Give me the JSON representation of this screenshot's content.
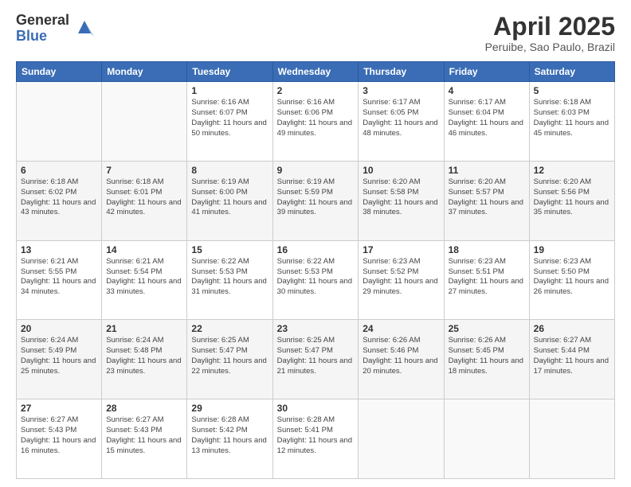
{
  "logo": {
    "general": "General",
    "blue": "Blue"
  },
  "title": {
    "month_year": "April 2025",
    "location": "Peruibe, Sao Paulo, Brazil"
  },
  "weekdays": [
    "Sunday",
    "Monday",
    "Tuesday",
    "Wednesday",
    "Thursday",
    "Friday",
    "Saturday"
  ],
  "weeks": [
    [
      {
        "day": "",
        "sunrise": "",
        "sunset": "",
        "daylight": ""
      },
      {
        "day": "",
        "sunrise": "",
        "sunset": "",
        "daylight": ""
      },
      {
        "day": "1",
        "sunrise": "Sunrise: 6:16 AM",
        "sunset": "Sunset: 6:07 PM",
        "daylight": "Daylight: 11 hours and 50 minutes."
      },
      {
        "day": "2",
        "sunrise": "Sunrise: 6:16 AM",
        "sunset": "Sunset: 6:06 PM",
        "daylight": "Daylight: 11 hours and 49 minutes."
      },
      {
        "day": "3",
        "sunrise": "Sunrise: 6:17 AM",
        "sunset": "Sunset: 6:05 PM",
        "daylight": "Daylight: 11 hours and 48 minutes."
      },
      {
        "day": "4",
        "sunrise": "Sunrise: 6:17 AM",
        "sunset": "Sunset: 6:04 PM",
        "daylight": "Daylight: 11 hours and 46 minutes."
      },
      {
        "day": "5",
        "sunrise": "Sunrise: 6:18 AM",
        "sunset": "Sunset: 6:03 PM",
        "daylight": "Daylight: 11 hours and 45 minutes."
      }
    ],
    [
      {
        "day": "6",
        "sunrise": "Sunrise: 6:18 AM",
        "sunset": "Sunset: 6:02 PM",
        "daylight": "Daylight: 11 hours and 43 minutes."
      },
      {
        "day": "7",
        "sunrise": "Sunrise: 6:18 AM",
        "sunset": "Sunset: 6:01 PM",
        "daylight": "Daylight: 11 hours and 42 minutes."
      },
      {
        "day": "8",
        "sunrise": "Sunrise: 6:19 AM",
        "sunset": "Sunset: 6:00 PM",
        "daylight": "Daylight: 11 hours and 41 minutes."
      },
      {
        "day": "9",
        "sunrise": "Sunrise: 6:19 AM",
        "sunset": "Sunset: 5:59 PM",
        "daylight": "Daylight: 11 hours and 39 minutes."
      },
      {
        "day": "10",
        "sunrise": "Sunrise: 6:20 AM",
        "sunset": "Sunset: 5:58 PM",
        "daylight": "Daylight: 11 hours and 38 minutes."
      },
      {
        "day": "11",
        "sunrise": "Sunrise: 6:20 AM",
        "sunset": "Sunset: 5:57 PM",
        "daylight": "Daylight: 11 hours and 37 minutes."
      },
      {
        "day": "12",
        "sunrise": "Sunrise: 6:20 AM",
        "sunset": "Sunset: 5:56 PM",
        "daylight": "Daylight: 11 hours and 35 minutes."
      }
    ],
    [
      {
        "day": "13",
        "sunrise": "Sunrise: 6:21 AM",
        "sunset": "Sunset: 5:55 PM",
        "daylight": "Daylight: 11 hours and 34 minutes."
      },
      {
        "day": "14",
        "sunrise": "Sunrise: 6:21 AM",
        "sunset": "Sunset: 5:54 PM",
        "daylight": "Daylight: 11 hours and 33 minutes."
      },
      {
        "day": "15",
        "sunrise": "Sunrise: 6:22 AM",
        "sunset": "Sunset: 5:53 PM",
        "daylight": "Daylight: 11 hours and 31 minutes."
      },
      {
        "day": "16",
        "sunrise": "Sunrise: 6:22 AM",
        "sunset": "Sunset: 5:53 PM",
        "daylight": "Daylight: 11 hours and 30 minutes."
      },
      {
        "day": "17",
        "sunrise": "Sunrise: 6:23 AM",
        "sunset": "Sunset: 5:52 PM",
        "daylight": "Daylight: 11 hours and 29 minutes."
      },
      {
        "day": "18",
        "sunrise": "Sunrise: 6:23 AM",
        "sunset": "Sunset: 5:51 PM",
        "daylight": "Daylight: 11 hours and 27 minutes."
      },
      {
        "day": "19",
        "sunrise": "Sunrise: 6:23 AM",
        "sunset": "Sunset: 5:50 PM",
        "daylight": "Daylight: 11 hours and 26 minutes."
      }
    ],
    [
      {
        "day": "20",
        "sunrise": "Sunrise: 6:24 AM",
        "sunset": "Sunset: 5:49 PM",
        "daylight": "Daylight: 11 hours and 25 minutes."
      },
      {
        "day": "21",
        "sunrise": "Sunrise: 6:24 AM",
        "sunset": "Sunset: 5:48 PM",
        "daylight": "Daylight: 11 hours and 23 minutes."
      },
      {
        "day": "22",
        "sunrise": "Sunrise: 6:25 AM",
        "sunset": "Sunset: 5:47 PM",
        "daylight": "Daylight: 11 hours and 22 minutes."
      },
      {
        "day": "23",
        "sunrise": "Sunrise: 6:25 AM",
        "sunset": "Sunset: 5:47 PM",
        "daylight": "Daylight: 11 hours and 21 minutes."
      },
      {
        "day": "24",
        "sunrise": "Sunrise: 6:26 AM",
        "sunset": "Sunset: 5:46 PM",
        "daylight": "Daylight: 11 hours and 20 minutes."
      },
      {
        "day": "25",
        "sunrise": "Sunrise: 6:26 AM",
        "sunset": "Sunset: 5:45 PM",
        "daylight": "Daylight: 11 hours and 18 minutes."
      },
      {
        "day": "26",
        "sunrise": "Sunrise: 6:27 AM",
        "sunset": "Sunset: 5:44 PM",
        "daylight": "Daylight: 11 hours and 17 minutes."
      }
    ],
    [
      {
        "day": "27",
        "sunrise": "Sunrise: 6:27 AM",
        "sunset": "Sunset: 5:43 PM",
        "daylight": "Daylight: 11 hours and 16 minutes."
      },
      {
        "day": "28",
        "sunrise": "Sunrise: 6:27 AM",
        "sunset": "Sunset: 5:43 PM",
        "daylight": "Daylight: 11 hours and 15 minutes."
      },
      {
        "day": "29",
        "sunrise": "Sunrise: 6:28 AM",
        "sunset": "Sunset: 5:42 PM",
        "daylight": "Daylight: 11 hours and 13 minutes."
      },
      {
        "day": "30",
        "sunrise": "Sunrise: 6:28 AM",
        "sunset": "Sunset: 5:41 PM",
        "daylight": "Daylight: 11 hours and 12 minutes."
      },
      {
        "day": "",
        "sunrise": "",
        "sunset": "",
        "daylight": ""
      },
      {
        "day": "",
        "sunrise": "",
        "sunset": "",
        "daylight": ""
      },
      {
        "day": "",
        "sunrise": "",
        "sunset": "",
        "daylight": ""
      }
    ]
  ]
}
